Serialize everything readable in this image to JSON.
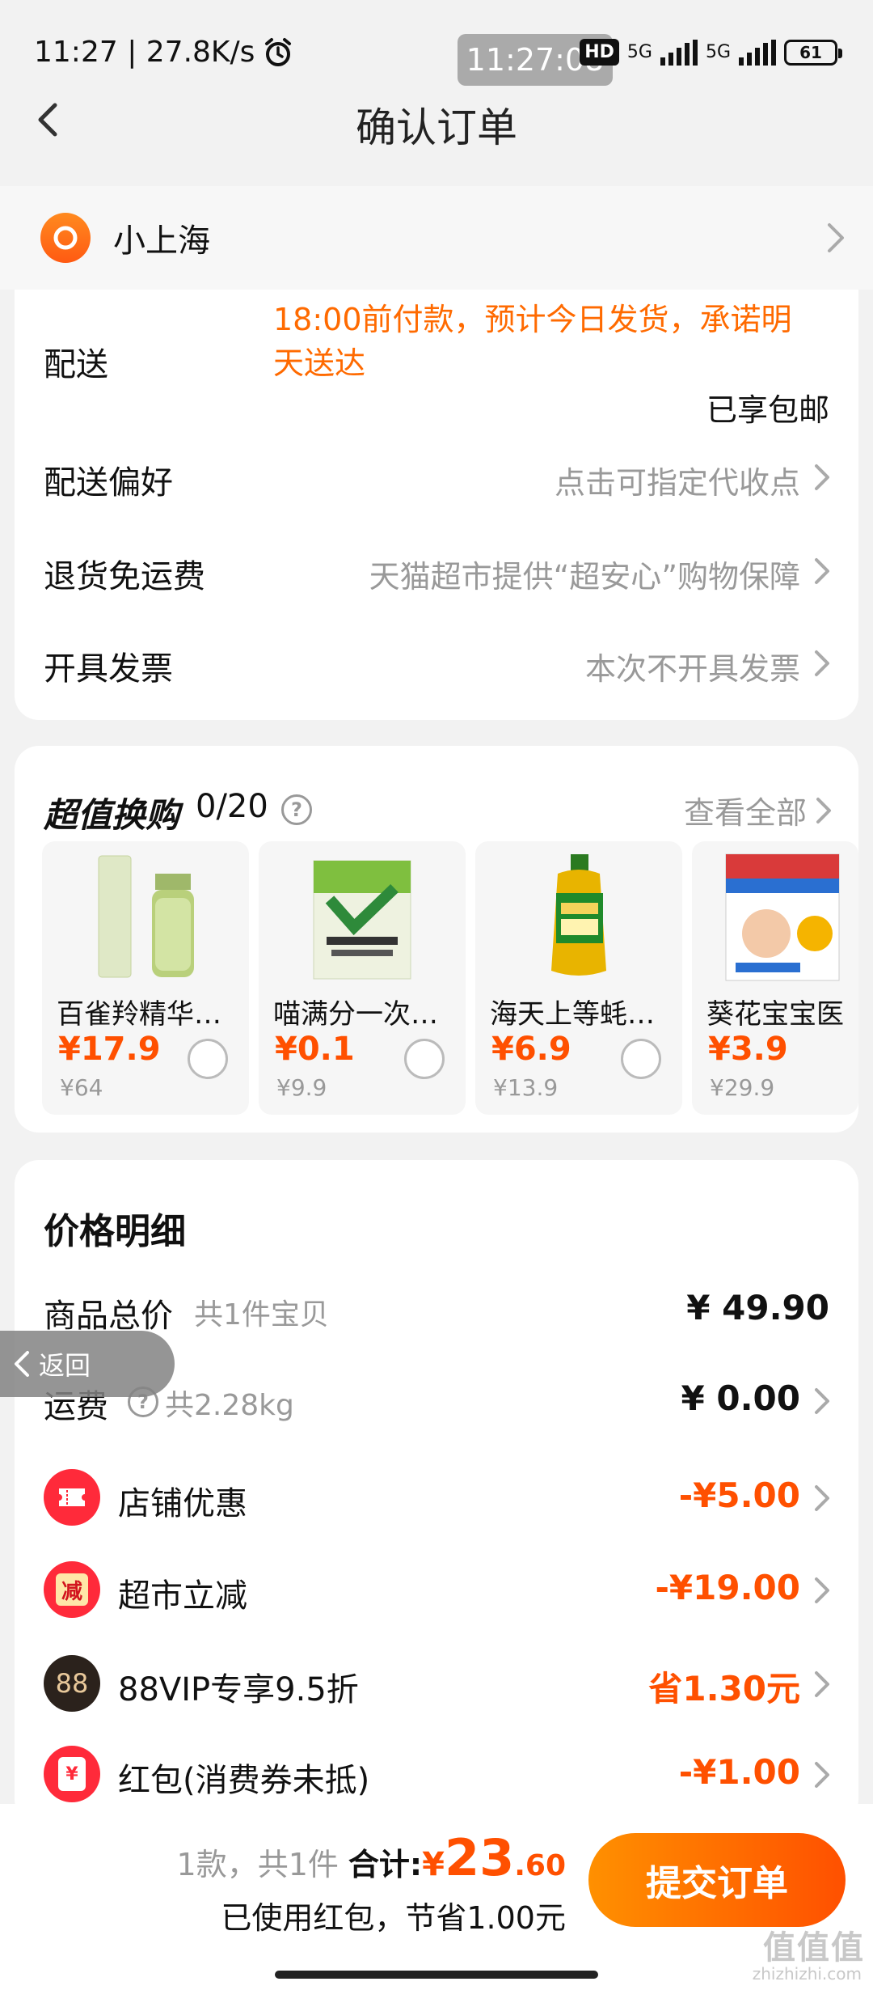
{
  "status_bar": {
    "left_text": "11:27 | 27.8K/s",
    "center_time": "11:27:08",
    "hd": "HD",
    "net1": "5G",
    "net2": "5G",
    "battery": "61"
  },
  "nav": {
    "title": "确认订单"
  },
  "address": {
    "text": "小上海"
  },
  "delivery": {
    "label": "配送",
    "promise_line1": "18:00前付款，预计今日发货，承诺明",
    "promise_line2": "天送达",
    "shipping_note": "已享包邮",
    "pref_label": "配送偏好",
    "pref_value": "点击可指定代收点",
    "return_label": "退货免运费",
    "return_value": "天猫超市提供“超安心”购物保障",
    "invoice_label": "开具发票",
    "invoice_value": "本次不开具发票"
  },
  "swap": {
    "title": "超值换购",
    "count": "0/20",
    "view_all": "查看全部",
    "products": [
      {
        "name": "百雀羚精华…",
        "price": "¥17.9",
        "orig": "¥64"
      },
      {
        "name": "喵满分一次…",
        "price": "¥0.1",
        "orig": "¥9.9"
      },
      {
        "name": "海天上等蚝…",
        "price": "¥6.9",
        "orig": "¥13.9"
      },
      {
        "name": "葵花宝宝医",
        "price": "¥3.9",
        "orig": "¥29.9"
      }
    ]
  },
  "price_detail": {
    "title": "价格明细",
    "goods_label": "商品总价",
    "goods_sub": "共1件宝贝",
    "goods_value": "¥ 49.90",
    "freight_label": "运费",
    "freight_sub": "共2.28kg",
    "freight_value": "¥ 0.00",
    "shop_label": "店铺优惠",
    "shop_value": "-¥5.00",
    "market_label": "超市立减",
    "market_value": "-¥19.00",
    "market_icon_text": "减",
    "vip_label": "88VIP专享9.5折",
    "vip_value": "省1.30元",
    "vip_icon_text": "88",
    "redpack_label": "红包(消费券未抵)",
    "redpack_value": "-¥1.00",
    "redpack_icon_text": "¥"
  },
  "back_pill": {
    "label": "返回"
  },
  "bottom": {
    "count_text": "1款，共1件",
    "total_label": "合计:",
    "currency": "¥",
    "total_int": "23",
    "total_dec": ".60",
    "saving_text": "已使用红包，节省1.00元",
    "submit": "提交订单"
  },
  "watermark": {
    "mark": "值值值",
    "site": "zhizhizhi.com"
  },
  "colors": {
    "accent": "#ff5000",
    "accent_light": "#ff9000"
  }
}
